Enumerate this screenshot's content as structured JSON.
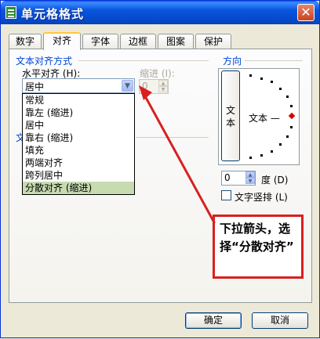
{
  "window": {
    "title": "单元格格式",
    "close_glyph": "✕"
  },
  "tabs": [
    {
      "label": "数字"
    },
    {
      "label": "对齐"
    },
    {
      "label": "字体"
    },
    {
      "label": "边框"
    },
    {
      "label": "图案"
    },
    {
      "label": "保护"
    }
  ],
  "alignment": {
    "group_label": "文本对齐方式",
    "horizontal_label": "水平对齐 (H):",
    "horizontal_value": "居中",
    "indent_label": "缩进 (I):",
    "indent_value": "0",
    "vertical_label_fragment": "文",
    "dropdown_options": [
      "常规",
      "靠左 (缩进)",
      "居中",
      "靠右 (缩进)",
      "填充",
      "两端对齐",
      "跨列居中",
      "分散对齐 (缩进)"
    ],
    "selected_option": "分散对齐 (缩进)"
  },
  "direction": {
    "group_label": "方向",
    "vertical_text": "文本",
    "horizontal_text": "文本 —",
    "degree_value": "0",
    "degree_label": "度 (D)",
    "vertical_checkbox_label": "文字竖排 (L)",
    "vertical_checked": false
  },
  "callout": {
    "text": "下拉箭头，选择“分散对齐”"
  },
  "buttons": {
    "ok": "确定",
    "cancel": "取消"
  },
  "colors": {
    "titlebar": "#0855dd",
    "group_label": "#0046d5",
    "annotation": "#d82020",
    "selected_row": "#c6dbb0"
  },
  "icons": [
    "app-spreadsheet-icon",
    "close-icon",
    "chevron-down-icon",
    "spin-up-icon",
    "spin-down-icon",
    "annotation-arrow-icon"
  ]
}
